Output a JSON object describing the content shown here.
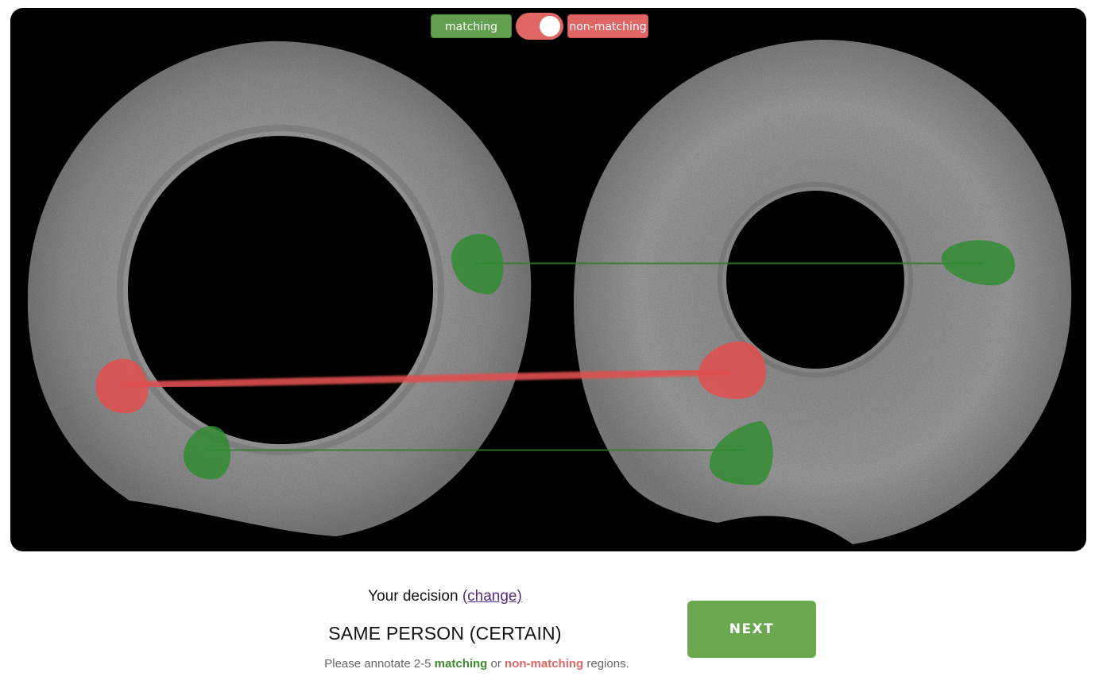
{
  "toggle": {
    "matching_label": "matching",
    "nonmatching_label": "non-matching",
    "state": "non-matching"
  },
  "colors": {
    "matching": "#2e8b2e",
    "nonmatching": "#e05050",
    "background": "#000000",
    "next_button": "#6aa84f"
  },
  "decision": {
    "prefix": "Your decision",
    "change_link": "(change)",
    "value": "SAME PERSON (CERTAIN)"
  },
  "next_label": "NEXT",
  "hint": {
    "part1": "Please annotate 2-5 ",
    "matching": "matching",
    "part2": " or ",
    "nonmatching": "non-matching",
    "part3": " regions."
  },
  "annotations": [
    {
      "type": "matching"
    },
    {
      "type": "non-matching"
    },
    {
      "type": "matching"
    }
  ]
}
